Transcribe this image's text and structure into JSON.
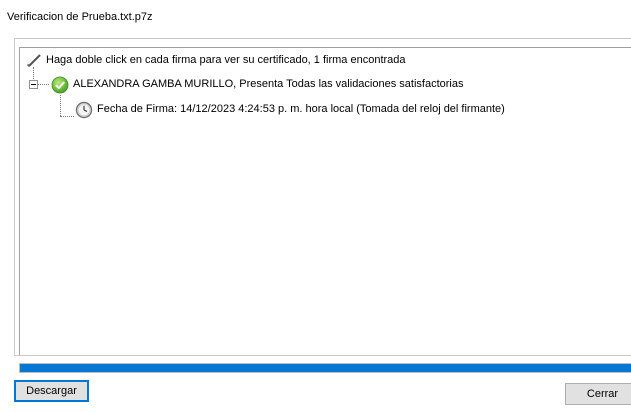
{
  "window": {
    "title": "Verificacion de Prueba.txt.p7z"
  },
  "tree": {
    "root": {
      "label": "Haga doble click en cada firma para ver su certificado, 1 firma encontrada",
      "icon": "pen-icon"
    },
    "signature": {
      "label": "ALEXANDRA GAMBA MURILLO, Presenta Todas las validaciones satisfactorias",
      "icon": "check-icon",
      "expanded": true
    },
    "timestamp": {
      "label": "Fecha de Firma: 14/12/2023 4:24:53 p. m. hora local (Tomada del reloj del firmante)",
      "icon": "clock-icon"
    }
  },
  "progress": {
    "value": 1.0
  },
  "buttons": {
    "download": "Descargar",
    "close": "Cerrar"
  },
  "colors": {
    "accent": "#0678d4",
    "success": "#5cb335"
  }
}
